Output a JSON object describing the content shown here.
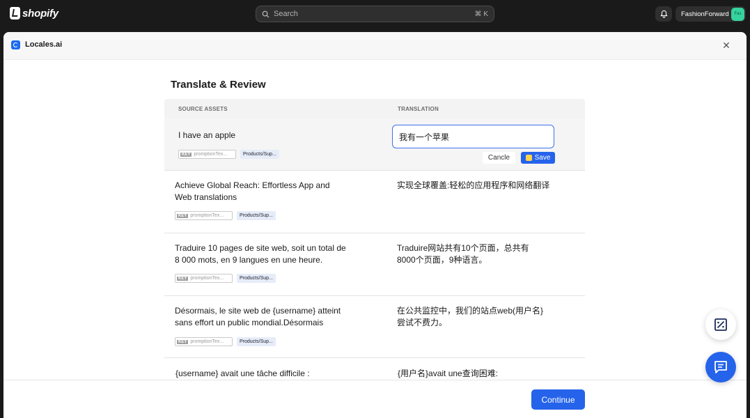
{
  "topbar": {
    "brand": "shopify",
    "search_placeholder": "Search",
    "search_shortcut": "⌘ K",
    "store_name": "FashionForward",
    "avatar_initials": "Fas"
  },
  "modal": {
    "app_name": "Locales.ai",
    "page_title": "Translate & Review",
    "columns": {
      "source": "SOURCE ASSETS",
      "translation": "TRANSLATION"
    },
    "rows": [
      {
        "source": "I have an apple",
        "translation": "我有一个苹果",
        "key_label": "KEY",
        "key_value": "promptionTex...",
        "path": "Products/Sup..."
      },
      {
        "source": "Achieve Global Reach: Effortless App and Web translations",
        "translation": "实现全球覆盖:轻松的应用程序和网络翻译",
        "key_label": "KEY",
        "key_value": "promptionTex...",
        "path": "Products/Sup..."
      },
      {
        "source": "Traduire 10 pages de site web, soit un total de 8 000 mots, en 9 langues en une heure.",
        "translation": "Traduire网站共有10个页面，总共有8000个页面，9种语言。",
        "key_label": "KEY",
        "key_value": "promptionTex...",
        "path": "Products/Sup..."
      },
      {
        "source": "Désormais, le site web de {username} atteint sans effort un public mondial.Désormais",
        "translation": "在公共监控中，我们的站点web(用户名}尝试不费力。",
        "key_label": "KEY",
        "key_value": "promptionTex...",
        "path": "Products/Sup..."
      },
      {
        "source": "{username} avait une tâche difficile :",
        "translation": "{用户名}avait une查询困难:"
      }
    ],
    "actions": {
      "cancel": "Cancle",
      "save": "Save"
    },
    "continue": "Continue"
  },
  "colors": {
    "accent": "#2563eb",
    "topbar": "#1a1a1a",
    "input_border": "#3d6ff0"
  }
}
